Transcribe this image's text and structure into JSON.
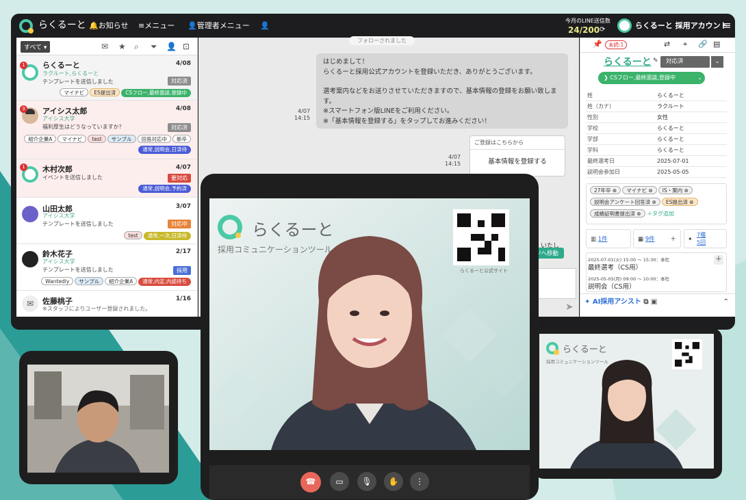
{
  "topbar": {
    "brand": "らくるーと",
    "nav": [
      "お知らせ",
      "メニュー",
      "管理者メニュー"
    ],
    "line_quota_label": "今月のLINE送信数",
    "line_quota_value": "24/200",
    "account": "らくるーと 採用アカウント"
  },
  "list": {
    "filter": "すべて",
    "items": [
      {
        "name": "らくるーと",
        "sub": "ラクルート,らくるーと",
        "msg": "テンプレートを送信しました",
        "date": "4/08",
        "status": "対応済",
        "status_color": "#8d8d8d",
        "badge": "1",
        "tags": [
          "マイナビ",
          "ES提出済"
        ],
        "pill": "CSフロー,最終面談,登録中",
        "pill_color": "#3bb36b"
      },
      {
        "name": "アイシス太郎",
        "sub": "アイシス大学",
        "msg": "福利厚生はどうなっていますか？",
        "date": "4/08",
        "status": "対応済",
        "status_color": "#8d8d8d",
        "badge": "3",
        "tags": [
          "紹介企業A",
          "マイナビ",
          "test",
          "サンプル",
          "田島対応中",
          "新卒"
        ],
        "pill": "通常,説明会,日済待",
        "pill_color": "#4a5cd6"
      },
      {
        "name": "木村次郎",
        "sub": "",
        "msg": "イベントを送信しました",
        "date": "4/07",
        "status": "要対応",
        "status_color": "#d84b3e",
        "badge": "1",
        "tags": [],
        "pill": "通常,説明会,予約済",
        "pill_color": "#4a5cd6"
      },
      {
        "name": "山田太郎",
        "sub": "アイシス大学",
        "msg": "テンプレートを送信しました",
        "date": "3/07",
        "status": "対応中",
        "status_color": "#e8833a",
        "badge": "",
        "tags": [
          "test"
        ],
        "pill": "通常,一次,日済待",
        "pill_color": "#c8b82a"
      },
      {
        "name": "鈴木花子",
        "sub": "アイシス大学",
        "msg": "テンプレートを送信しました",
        "date": "2/17",
        "status": "採用",
        "status_color": "#4a6fd6",
        "badge": "",
        "tags": [
          "Wantedly",
          "サンプル",
          "紹介企業A"
        ],
        "pill": "通常,内定,内諾待ち",
        "pill_color": "#d84b3e"
      },
      {
        "name": "佐藤桃子",
        "sub": "",
        "msg": "※スタッフによりユーザー登録されました。",
        "date": "1/16",
        "status": "",
        "status_color": "",
        "badge": "",
        "tags": [],
        "pill": "",
        "pill_color": ""
      }
    ]
  },
  "chat": {
    "followed": "フォローされました",
    "message_lines": [
      "はじめまして！",
      "らくるーと採用公式アカウントを登録いただき、ありがとうございます。",
      "",
      "選考案内などをお送りさせていただきますので、基本情報の登録をお願い致しま",
      "す。",
      "※スマートフォン版LINEをご利用ください。",
      "※「基本情報を登録する」をタップしてお進みください！"
    ],
    "message_time_date": "4/07",
    "message_time": "14:15",
    "card_header": "ご登録はこちらから",
    "card_button": "基本情報を登録する",
    "card_time_date": "4/07",
    "card_time": "14:15",
    "partial_text": "いたし",
    "partial_button": "ジへ移動"
  },
  "profile": {
    "unread": "未読:1",
    "name": "らくるーと",
    "status": "対応済",
    "flow": "CSフロー,最終面談,登録中",
    "fields": [
      {
        "k": "姓",
        "v": "らくるーと"
      },
      {
        "k": "姓（カナ）",
        "v": "ラクルート"
      },
      {
        "k": "性別",
        "v": "女性"
      },
      {
        "k": "学校",
        "v": "らくるーと"
      },
      {
        "k": "学部",
        "v": "らくるーと"
      },
      {
        "k": "学科",
        "v": "らくるーと"
      },
      {
        "k": "最終選考日",
        "v": "2025-07-01"
      },
      {
        "k": "説明会参加日",
        "v": "2025-05-05"
      }
    ],
    "tags": [
      "27年卒",
      "マイナビ",
      "IS・案内",
      "説明会アンケート回答済",
      "ES提出済",
      "成績証明書提出済"
    ],
    "add_tag": "＋タグ追加",
    "count1": "1件",
    "count2": "9件",
    "count3a": "7種",
    "count3b": "5回",
    "events": [
      {
        "when": "2025-07-01(火) 15:00 ～ 15:30：本社",
        "title": "最終選考（CS用）"
      },
      {
        "when": "2025-05-05(月) 09:00 ～ 10:00：本社",
        "title": "説明会（CS用）"
      }
    ],
    "assist": "AI採用アシスト"
  },
  "video": {
    "brand": "らくるーと",
    "tagline": "採用コミュニケーションツール",
    "qr_caption": "らくるーと公式サイト"
  },
  "colors": {
    "brand": "#4bc9a6",
    "accent": "#f7c948",
    "end_call": "#e8675a"
  }
}
